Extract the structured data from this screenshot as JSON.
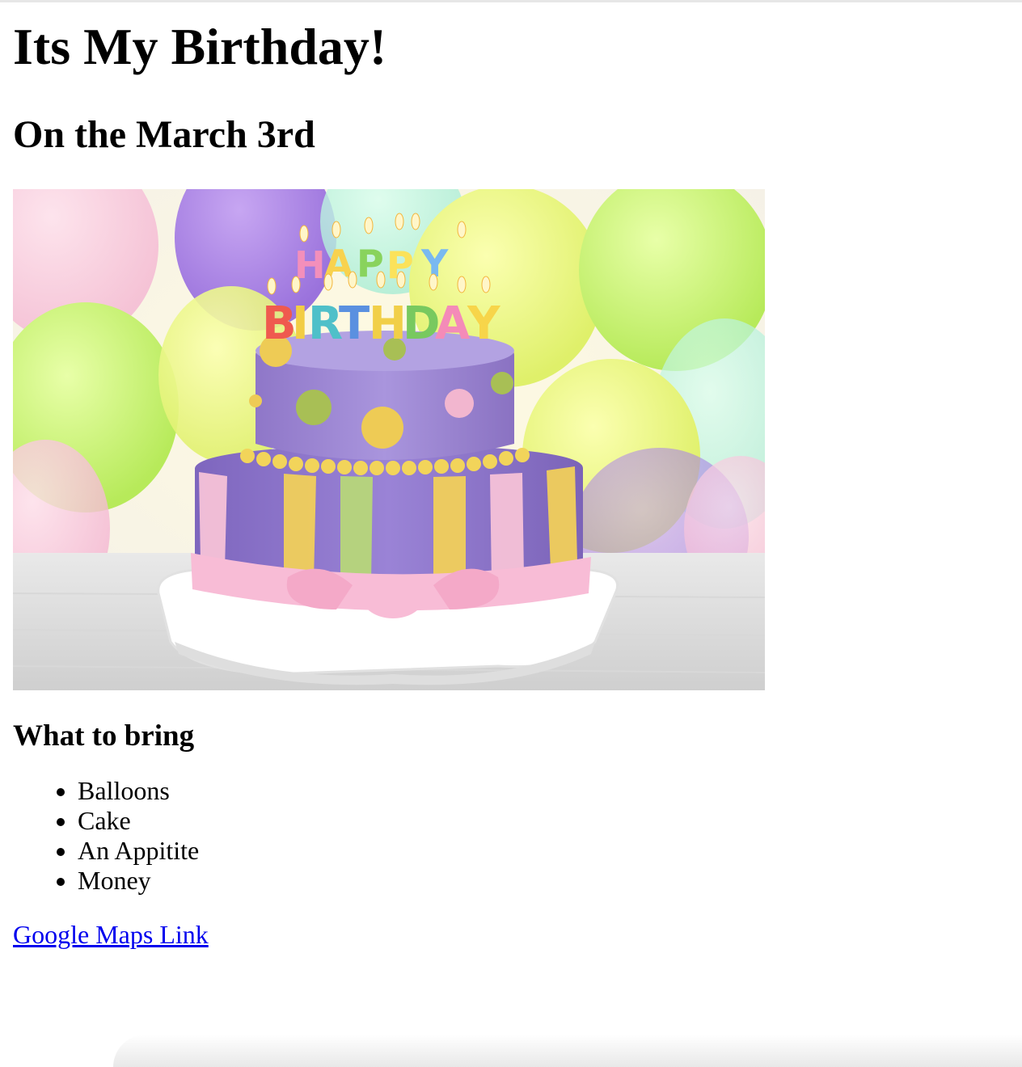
{
  "page": {
    "title": "Its My Birthday!",
    "subtitle": "On the March 3rd",
    "image_alt": "birthday-cake-image",
    "section_heading": "What to bring",
    "bring_items": [
      "Balloons",
      "Cake",
      "An Appitite",
      "Money"
    ],
    "map_link_label": "Google Maps Link"
  },
  "colors": {
    "link": "#0000ee",
    "text": "#000000",
    "background": "#ffffff"
  }
}
